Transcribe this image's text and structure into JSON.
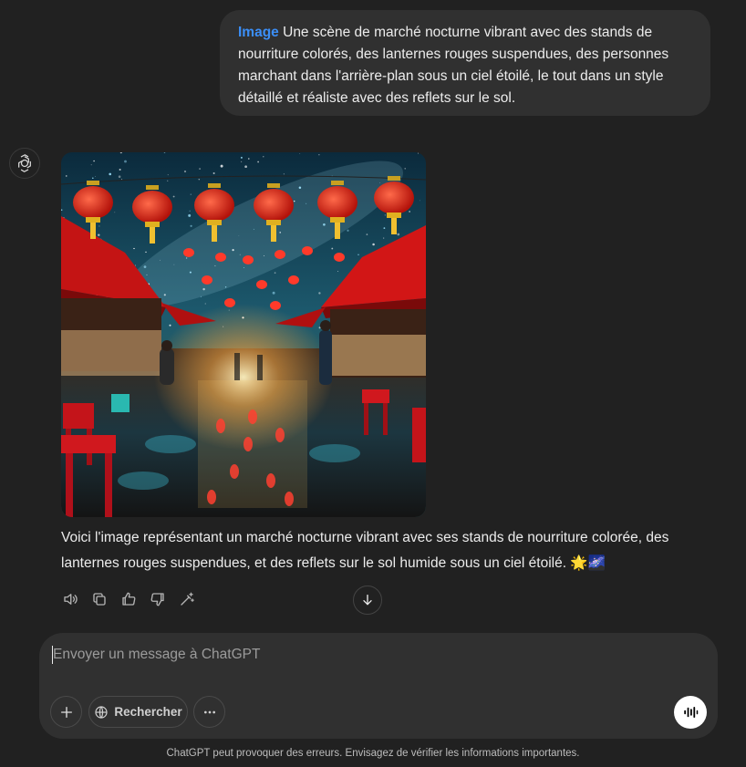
{
  "user_message": {
    "tag": "Image",
    "text": " Une scène de marché nocturne vibrant avec des stands de nourriture colorés, des lanternes rouges suspendues, des personnes marchant dans l'arrière-plan sous un ciel étoilé, le tout dans un style détaillé et réaliste avec des reflets sur le sol."
  },
  "assistant": {
    "avatar_icon": "chatgpt-logo-icon",
    "image_icon": "generated-night-market-image",
    "text": "Voici l'image représentant un marché nocturne vibrant avec ses stands de nourriture colorée, des lanternes rouges suspendues, et des reflets sur le sol humide sous un ciel étoilé. 🌟🌌",
    "actions": [
      "speaker-icon",
      "copy-icon",
      "thumbs-up-icon",
      "thumbs-down-icon",
      "edit-image-icon"
    ]
  },
  "composer": {
    "placeholder": "Envoyer un message à ChatGPT",
    "search_label": "Rechercher",
    "plus_icon": "plus-icon",
    "globe_icon": "globe-icon",
    "more_icon": "more-icon",
    "voice_icon": "voice-mode-icon"
  },
  "footer": {
    "disclaimer": "ChatGPT peut provoquer des erreurs. Envisagez de vérifier les informations importantes."
  },
  "colors": {
    "background": "#212121",
    "bubble": "#303030",
    "accent": "#3b8ef6"
  }
}
